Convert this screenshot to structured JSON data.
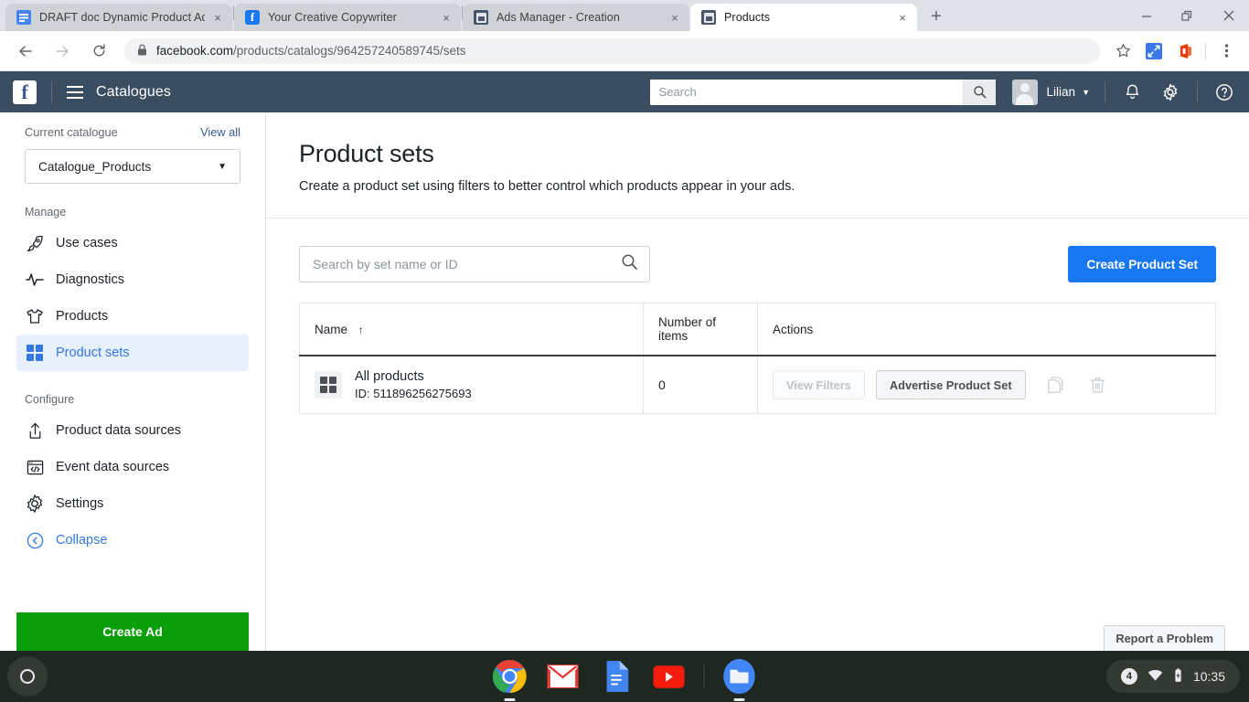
{
  "browser": {
    "tabs": [
      {
        "title": "DRAFT doc Dynamic Product Ad",
        "favicon": "google-docs-icon",
        "active": false
      },
      {
        "title": "Your Creative Copywriter",
        "favicon": "facebook-icon",
        "active": false
      },
      {
        "title": "Ads Manager - Creation",
        "favicon": "ads-manager-icon",
        "active": false
      },
      {
        "title": "Products",
        "favicon": "ads-manager-icon",
        "active": true
      }
    ],
    "new_tab_label": "+",
    "close_label": "×",
    "window_controls": {
      "minimize": "–",
      "maximize": "❐",
      "close": "✕"
    },
    "nav": {
      "back": "←",
      "forward": "→",
      "reload": "↻"
    },
    "address": {
      "lock": "🔒",
      "host": "facebook.com",
      "path": "/products/catalogs/964257240589745/sets"
    },
    "toolbar_icons": [
      "bookmark-star-icon",
      "extension-icon",
      "office-icon",
      "chrome-menu-icon"
    ]
  },
  "fbheader": {
    "logo": "f",
    "title": "Catalogues",
    "search_placeholder": "Search",
    "search_value": "",
    "user_name": "Lilian",
    "icons": [
      "notifications-bell-icon",
      "settings-gear-icon",
      "help-question-icon"
    ]
  },
  "sidebar": {
    "current_label": "Current catalogue",
    "view_all": "View all",
    "catalogue_selected": "Catalogue_Products",
    "sections": [
      {
        "heading": "Manage",
        "items": [
          {
            "label": "Use cases",
            "icon": "rocket-icon",
            "active": false
          },
          {
            "label": "Diagnostics",
            "icon": "pulse-icon",
            "active": false
          },
          {
            "label": "Products",
            "icon": "tshirt-icon",
            "active": false
          },
          {
            "label": "Product sets",
            "icon": "grid-squares-icon",
            "active": true
          }
        ]
      },
      {
        "heading": "Configure",
        "items": [
          {
            "label": "Product data sources",
            "icon": "upload-icon",
            "active": false
          },
          {
            "label": "Event data sources",
            "icon": "code-window-icon",
            "active": false
          },
          {
            "label": "Settings",
            "icon": "gear-icon",
            "active": false
          },
          {
            "label": "Collapse",
            "icon": "chevron-left-circle-icon",
            "active": false
          }
        ]
      }
    ],
    "create_ad": "Create Ad"
  },
  "main": {
    "title": "Product sets",
    "subtitle": "Create a product set using filters to better control which products appear in your ads.",
    "search_placeholder": "Search by set name or ID",
    "search_value": "",
    "create_button": "Create Product Set",
    "table": {
      "columns": [
        "Name",
        "Number of items",
        "Actions"
      ],
      "sort_indicator": "↑",
      "rows": [
        {
          "name": "All products",
          "id": "ID: 511896256275693",
          "items": "0",
          "view_filters": "View Filters",
          "advertise": "Advertise Product Set",
          "duplicate_icon": "copy-icon",
          "delete_icon": "trash-icon"
        }
      ]
    },
    "report_problem": "Report a Problem"
  },
  "shelf": {
    "launcher": "launcher-icon",
    "apps": [
      "chrome-icon",
      "gmail-icon",
      "google-docs-icon",
      "youtube-icon",
      "files-icon"
    ],
    "battery_count": "4",
    "time": "10:35"
  },
  "colors": {
    "fb_header": "#3b4d61",
    "fb_blue": "#1877f2",
    "active_nav_bg": "#e7f0fd",
    "active_nav_text": "#3578e5",
    "create_ad_green": "#0a9f0a",
    "shelf": "#1f2721"
  }
}
